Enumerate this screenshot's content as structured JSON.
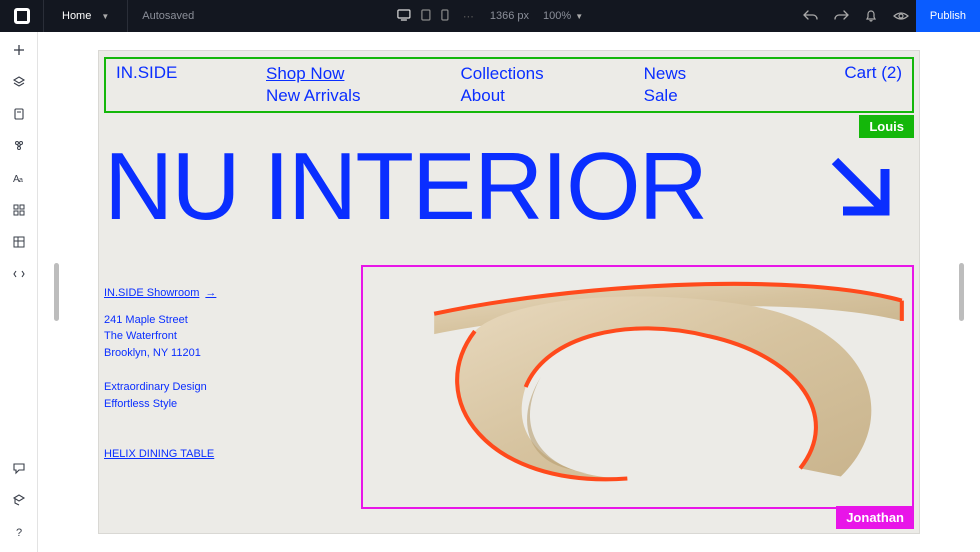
{
  "topbar": {
    "home_label": "Home",
    "autosaved": "Autosaved",
    "canvas_width": "1366 px",
    "zoom": "100%",
    "publish": "Publish"
  },
  "site": {
    "brand": "IN.SIDE",
    "nav": {
      "col1": [
        "Shop Now",
        "New Arrivals"
      ],
      "col2": [
        "Collections",
        "About"
      ],
      "col3": [
        "News",
        "Sale"
      ]
    },
    "cart_label": "Cart (2)",
    "hero": "NU INTERIOR",
    "showroom_link": "IN.SIDE Showroom",
    "address": {
      "line1": "241 Maple Street",
      "line2": "The Waterfront",
      "line3": "Brooklyn, NY 11201"
    },
    "tagline": {
      "line1": "Extraordinary Design",
      "line2": "Effortless Style"
    },
    "product_name": "HELIX DINING TABLE"
  },
  "collab": {
    "user1": "Louis",
    "user2": "Jonathan"
  },
  "colors": {
    "brand_blue": "#0a2eff",
    "select_green": "#14b70a",
    "select_magenta": "#e815e8",
    "accent_orange": "#ff4a1c"
  }
}
